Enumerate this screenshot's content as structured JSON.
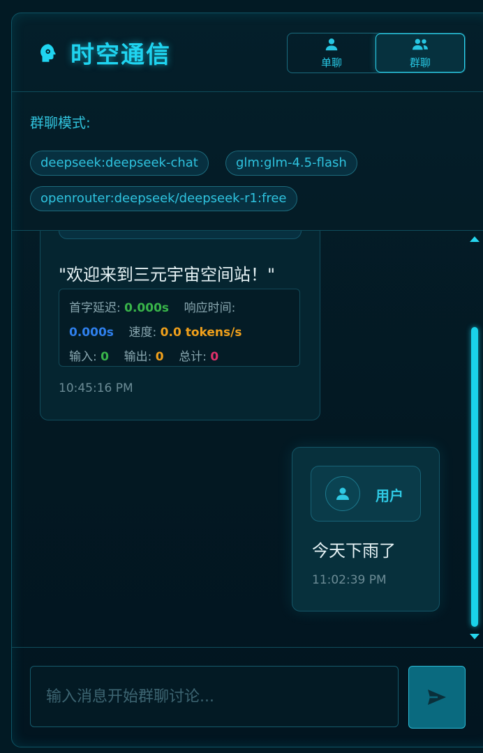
{
  "header": {
    "title": "时空通信"
  },
  "mode_switch": {
    "single_label": "单聊",
    "group_label": "群聊",
    "active": "group"
  },
  "models": {
    "title": "群聊模式:",
    "chips": [
      "deepseek:deepseek-chat",
      "glm:glm-4.5-flash",
      "openrouter:deepseek/deepseek-r1:free"
    ]
  },
  "messages": {
    "bot": {
      "text": "\"欢迎来到三元宇宙空间站！\"",
      "stats": {
        "first_token_label": "首字延迟:",
        "first_token_value": "0.000s",
        "response_label": "响应时间:",
        "response_value": "0.000s",
        "speed_label": "速度:",
        "speed_value": "0.0 tokens/s",
        "input_label": "输入:",
        "input_value": "0",
        "output_label": "输出:",
        "output_value": "0",
        "total_label": "总计:",
        "total_value": "0"
      },
      "time": "10:45:16 PM"
    },
    "user": {
      "name": "用户",
      "text": "今天下雨了",
      "time": "11:02:39 PM"
    }
  },
  "composer": {
    "placeholder": "输入消息开始群聊讨论..."
  },
  "colors": {
    "accent": "#1fd4f0",
    "green": "#39b54a",
    "blue": "#2f80ed",
    "orange": "#f0a01b",
    "pink": "#e0306a"
  }
}
